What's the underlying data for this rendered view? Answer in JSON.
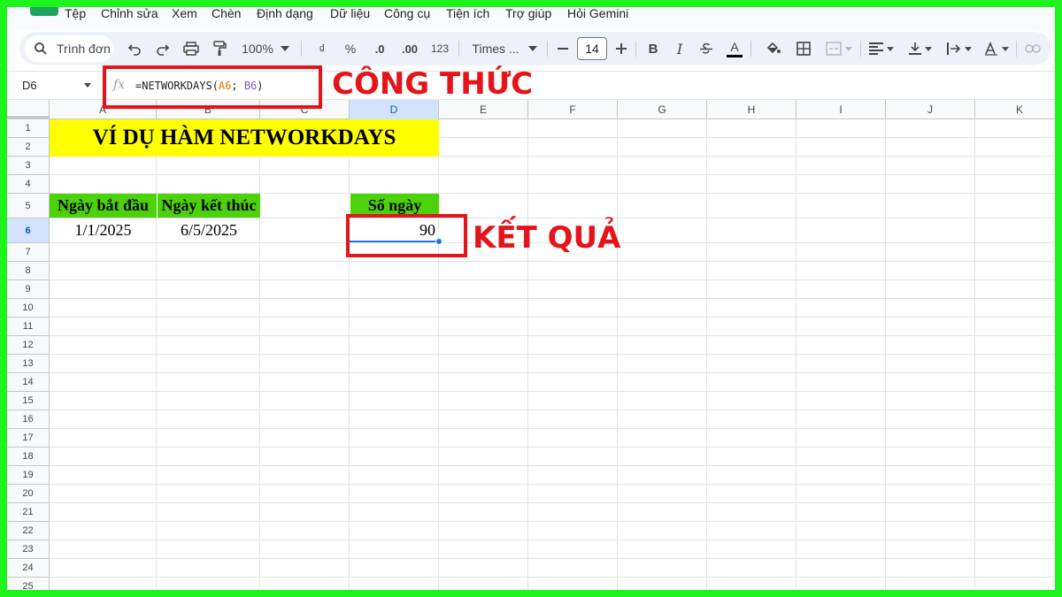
{
  "menu": {
    "items": [
      "Tệp",
      "Chỉnh sửa",
      "Xem",
      "Chèn",
      "Định dạng",
      "Dữ liệu",
      "Công cụ",
      "Tiện ích",
      "Trợ giúp",
      "Hỏi Gemini"
    ]
  },
  "toolbar": {
    "search_label": "Trình đơn",
    "zoom": "100%",
    "currency": "₫",
    "percent": "%",
    "dec_decrease": ".0",
    "dec_increase": ".00",
    "number_format": "123",
    "font_name": "Times ...",
    "font_size": "14",
    "bold": "B",
    "italic": "I",
    "text_color": "A"
  },
  "formula_bar": {
    "name_box": "D6",
    "fx": "fx",
    "formula_prefix": "=NETWORKDAYS(",
    "ref_a": "A6",
    "separator": "; ",
    "ref_b": "B6",
    "formula_suffix": ")"
  },
  "annotations": {
    "formula_label": "CÔNG THỨC",
    "result_label": "KẾT QUẢ"
  },
  "grid": {
    "columns": [
      "A",
      "B",
      "C",
      "D",
      "E",
      "F",
      "G",
      "H",
      "I",
      "J",
      "K"
    ],
    "rows": [
      "1",
      "2",
      "3",
      "4",
      "5",
      "6",
      "7",
      "8",
      "9",
      "10",
      "11",
      "12",
      "13",
      "14",
      "15",
      "16",
      "17",
      "18",
      "19",
      "20",
      "21",
      "22",
      "23",
      "24",
      "25"
    ],
    "active_column": "D",
    "active_row": "6"
  },
  "cells": {
    "title": "VÍ DỤ HÀM NETWORKDAYS",
    "header_start": "Ngày bắt đầu",
    "header_end": "Ngày kết thúc",
    "header_days": "Số ngày",
    "start_date": "1/1/2025",
    "end_date": "6/5/2025",
    "result": "90"
  },
  "colors": {
    "frame": "#1df41d",
    "title_fill": "#ffff00",
    "header_fill": "#4cd20a",
    "annotation": "#e5131a",
    "selection": "#1a73e8"
  }
}
